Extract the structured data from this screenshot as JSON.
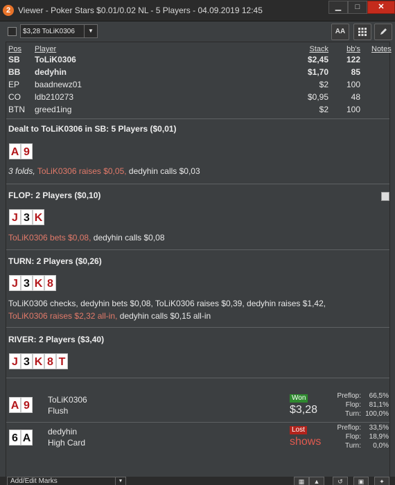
{
  "window": {
    "icon_label": "2",
    "title": "Viewer - Poker Stars $0.01/0.02 NL - 5 Players - 04.09.2019 12:45",
    "min_glyph": "▁",
    "max_glyph": "□",
    "close_glyph": "✕"
  },
  "toolbar": {
    "hand_select_value": "$3,28 ToLiK0306",
    "font_btn_label": "AA",
    "grid_icon": "grid-icon",
    "edit_icon": "pencil-icon"
  },
  "players_table": {
    "headers": {
      "pos": "Pos",
      "player": "Player",
      "stack": "Stack",
      "bbs": "bb's",
      "notes": "Notes"
    },
    "rows": [
      {
        "pos": "SB",
        "player": "ToLiK0306",
        "stack": "$2,45",
        "bbs": "122",
        "bold": true
      },
      {
        "pos": "BB",
        "player": "dedyhin",
        "stack": "$1,70",
        "bbs": "85",
        "bold": true
      },
      {
        "pos": "EP",
        "player": "baadnewz01",
        "stack": "$2",
        "bbs": "100",
        "bold": false
      },
      {
        "pos": "CO",
        "player": "ldb210273",
        "stack": "$0,95",
        "bbs": "48",
        "bold": false
      },
      {
        "pos": "BTN",
        "player": "greed1ing",
        "stack": "$2",
        "bbs": "100",
        "bold": false
      }
    ]
  },
  "streets": {
    "preflop": {
      "header": "Dealt to ToLiK0306 in SB: 5 Players ($0,01)",
      "cards": [
        "A",
        "9"
      ],
      "actions": [
        {
          "text": "3 folds,",
          "style": "italic"
        },
        {
          "text": " ToLiK0306 raises $0,05,",
          "style": "hero"
        },
        {
          "text": " dedyhin calls $0,03",
          "style": "normal"
        }
      ]
    },
    "flop": {
      "header": "FLOP: 2 Players ($0,10)",
      "cards": [
        "J",
        "3",
        "K"
      ],
      "actions": [
        {
          "text": "ToLiK0306 bets $0,08,",
          "style": "hero"
        },
        {
          "text": " dedyhin calls $0,08",
          "style": "normal"
        }
      ]
    },
    "turn": {
      "header": "TURN: 2 Players ($0,26)",
      "cards": [
        "J",
        "3",
        "K",
        "8"
      ],
      "line1": "ToLiK0306 checks, dedyhin bets $0,08, ToLiK0306 raises $0,39, dedyhin raises $1,42,",
      "line2_hero": "ToLiK0306 raises $2,32 all-in,",
      "line2_rest": " dedyhin calls $0,15 all-in"
    },
    "river": {
      "header": "RIVER: 2 Players ($3,40)",
      "cards": [
        "J",
        "3",
        "K",
        "8",
        "T"
      ]
    }
  },
  "results": [
    {
      "cards": [
        "A",
        "9"
      ],
      "name": "ToLiK0306",
      "hand": "Flush",
      "badge": "Won",
      "amount": "$3,28",
      "stats": [
        {
          "label": "Preflop:",
          "value": "66,5%"
        },
        {
          "label": "Flop:",
          "value": "81,1%"
        },
        {
          "label": "Turn:",
          "value": "100,0%"
        }
      ]
    },
    {
      "cards": [
        "6",
        "A"
      ],
      "name": "dedyhin",
      "hand": "High Card",
      "badge": "Lost",
      "amount": "shows",
      "stats": [
        {
          "label": "Preflop:",
          "value": "33,5%"
        },
        {
          "label": "Flop:",
          "value": "18,9%"
        },
        {
          "label": "Turn:",
          "value": "0,0%"
        }
      ]
    }
  ],
  "bottom": {
    "marks_label": "Add/Edit Marks"
  },
  "colors": {
    "hero_action": "#e27a6a",
    "won": "#2f8a2f",
    "lost": "#b3231c",
    "red_card": "#b3171b"
  }
}
